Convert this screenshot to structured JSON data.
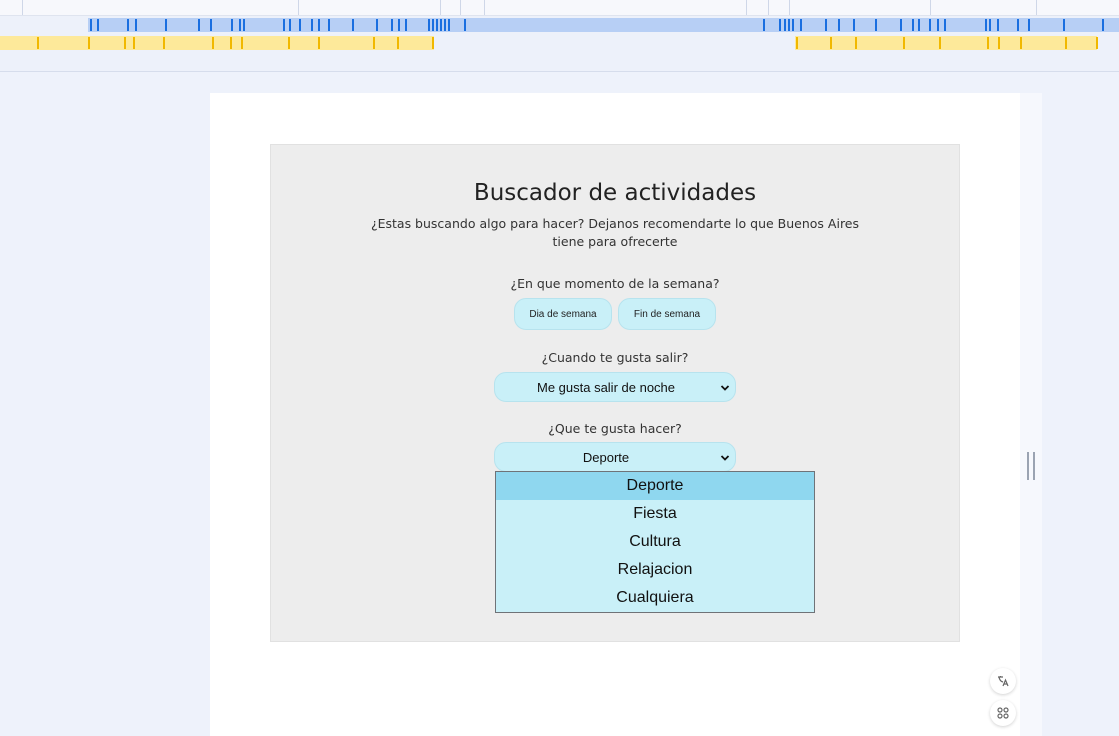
{
  "activity_finder": {
    "title": "Buscador de actividades",
    "subtitle": "¿Estas buscando algo para hacer? Dejanos recomendarte lo que Buenos Aires tiene para ofrecerte",
    "week_question": "¿En que momento de la semana?",
    "week_options": {
      "weekday": "Dia de semana",
      "weekend": "Fin de semana"
    },
    "time_question": "¿Cuando te gusta salir?",
    "time_selected": "Me gusta salir de noche",
    "activity_question": "¿Que te gusta hacer?",
    "activity_selected": "Deporte",
    "activity_options": [
      "Deporte",
      "Fiesta",
      "Cultura",
      "Relajacion",
      "Cualquiera"
    ]
  },
  "colors": {
    "timeline_blue": "#1a6fe0",
    "timeline_yellow": "#f1b800",
    "button_fill": "#c9f0f8",
    "option_highlight": "#8fd7ef"
  },
  "icons": {
    "floating_top": "translate-icon",
    "floating_bottom": "command-icon",
    "select_arrow": "chevron-down-icon"
  }
}
